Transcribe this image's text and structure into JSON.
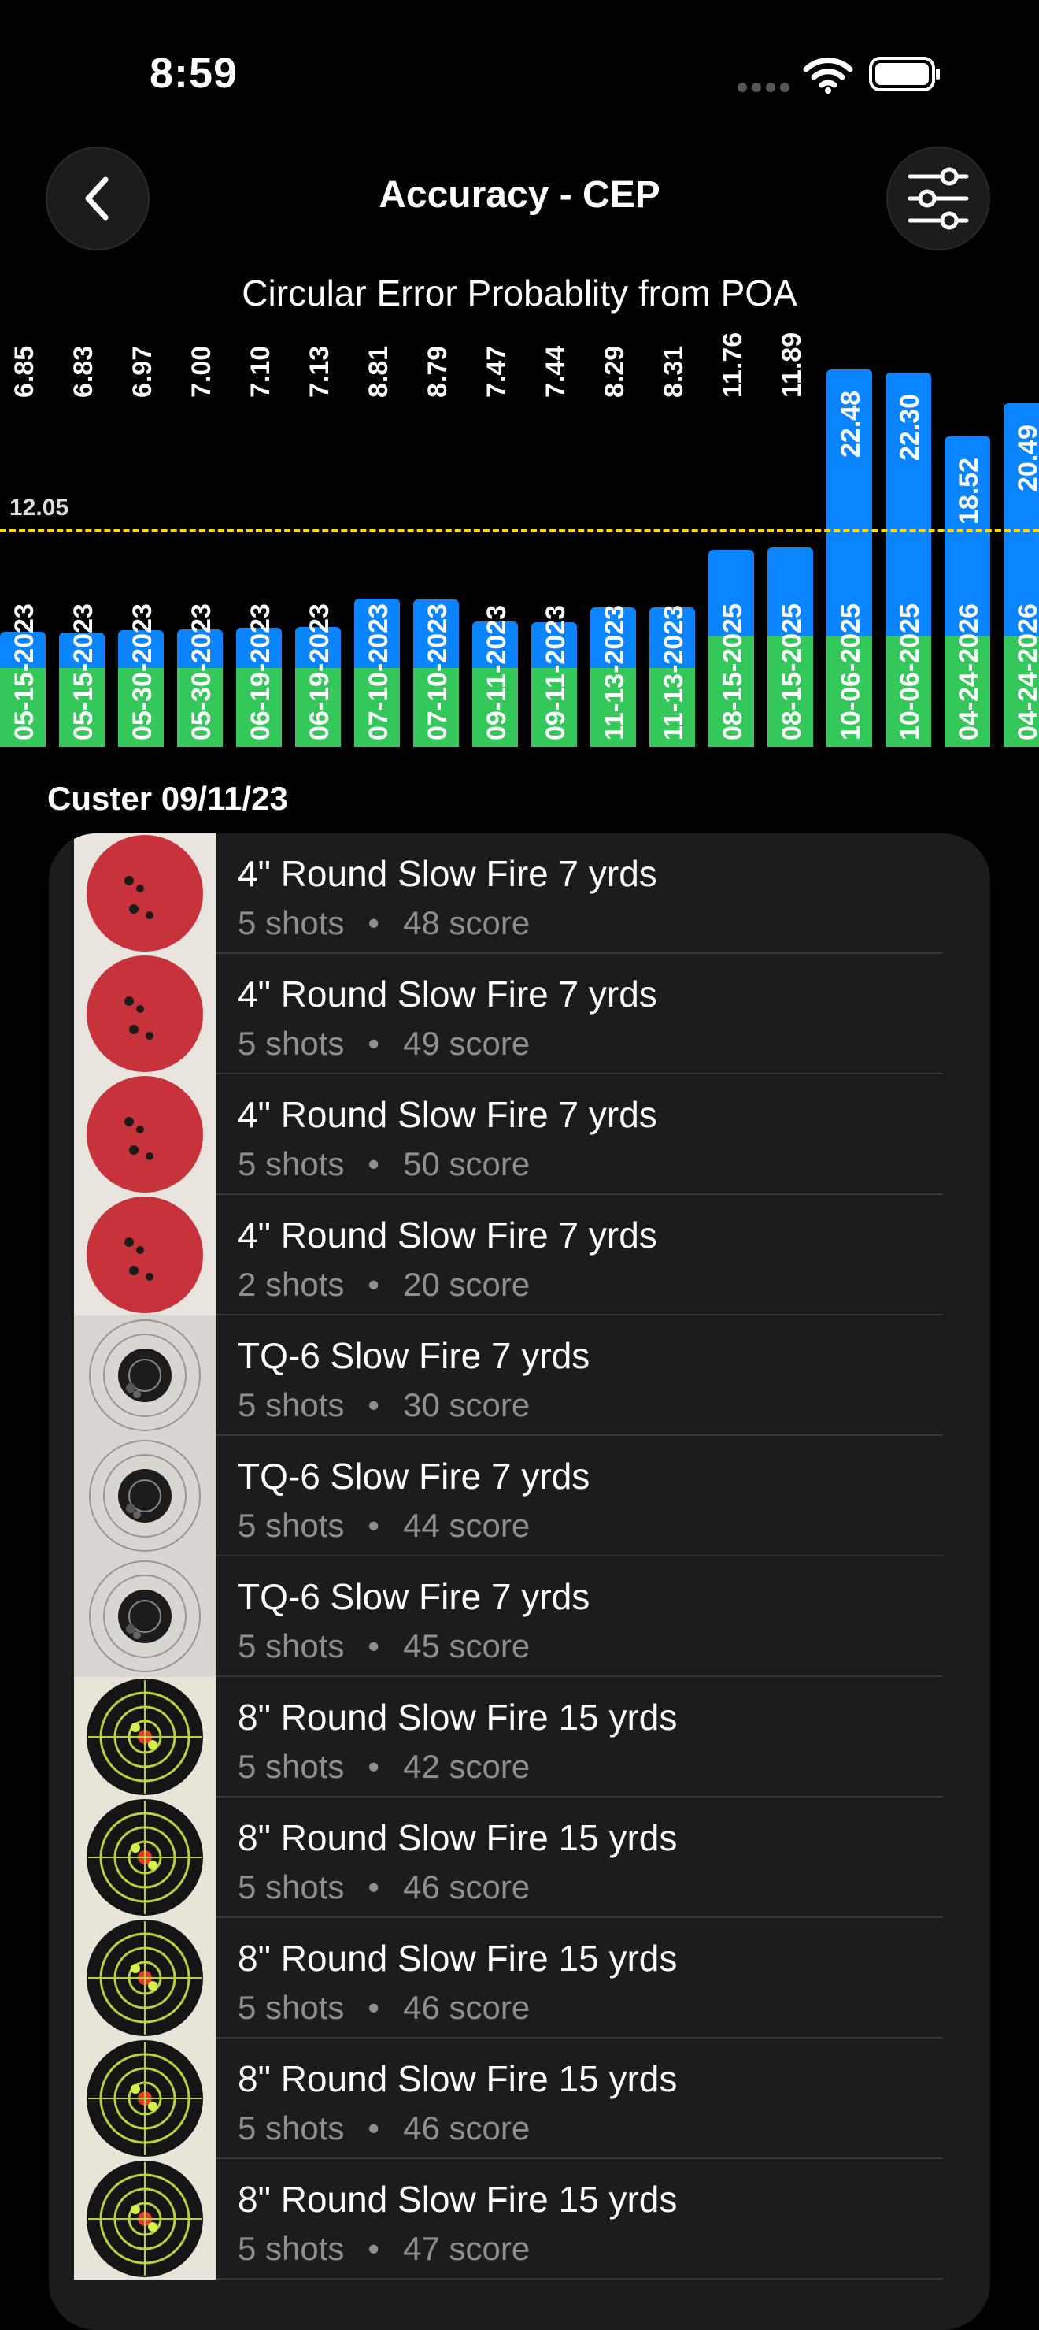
{
  "status": {
    "time": "8:59"
  },
  "nav": {
    "title": "Accuracy - CEP"
  },
  "chart_data": {
    "type": "bar",
    "title": "Circular Error Probablity from POA",
    "categories": [
      "05-15-2023",
      "05-15-2023",
      "05-30-2023",
      "05-30-2023",
      "06-19-2023",
      "06-19-2023",
      "07-10-2023",
      "07-10-2023",
      "09-11-2023",
      "09-11-2023",
      "11-13-2023",
      "11-13-2023",
      "08-15-2025",
      "08-15-2025",
      "10-06-2025",
      "10-06-2025",
      "04-24-2026",
      "04-24-2026"
    ],
    "values": [
      6.85,
      6.83,
      6.97,
      7.0,
      7.1,
      7.13,
      8.81,
      8.79,
      7.47,
      7.44,
      8.29,
      8.31,
      11.76,
      11.89,
      22.48,
      22.3,
      18.52,
      20.49
    ],
    "average_line": {
      "label": "12.05",
      "value": 12.05
    },
    "colors": {
      "base": "#34c759",
      "top": "#0a84ff",
      "average": "#ffd60a"
    }
  },
  "section": {
    "title": "Custer 09/11/23"
  },
  "sessions": [
    {
      "title": "4\" Round Slow Fire 7 yrds",
      "shots": "5 shots",
      "score": "48 score",
      "target": "red"
    },
    {
      "title": "4\" Round Slow Fire 7 yrds",
      "shots": "5 shots",
      "score": "49 score",
      "target": "red"
    },
    {
      "title": "4\" Round Slow Fire 7 yrds",
      "shots": "5 shots",
      "score": "50 score",
      "target": "red"
    },
    {
      "title": "4\" Round Slow Fire 7 yrds",
      "shots": "2 shots",
      "score": "20 score",
      "target": "red"
    },
    {
      "title": "TQ-6 Slow Fire 7 yrds",
      "shots": "5 shots",
      "score": "30 score",
      "target": "tq6"
    },
    {
      "title": "TQ-6 Slow Fire 7 yrds",
      "shots": "5 shots",
      "score": "44 score",
      "target": "tq6"
    },
    {
      "title": "TQ-6 Slow Fire 7 yrds",
      "shots": "5 shots",
      "score": "45 score",
      "target": "tq6"
    },
    {
      "title": "8\" Round Slow Fire 15 yrds",
      "shots": "5 shots",
      "score": "42 score",
      "target": "splatter"
    },
    {
      "title": "8\" Round Slow Fire 15 yrds",
      "shots": "5 shots",
      "score": "46 score",
      "target": "splatter"
    },
    {
      "title": "8\" Round Slow Fire 15 yrds",
      "shots": "5 shots",
      "score": "46 score",
      "target": "splatter"
    },
    {
      "title": "8\" Round Slow Fire 15 yrds",
      "shots": "5 shots",
      "score": "46 score",
      "target": "splatter"
    },
    {
      "title": "8\" Round Slow Fire 15 yrds",
      "shots": "5 shots",
      "score": "47 score",
      "target": "splatter"
    }
  ],
  "icons": {
    "back": "chevron-left-icon",
    "filter": "sliders-icon",
    "wifi": "wifi-icon",
    "battery": "battery-icon",
    "signal": "cellular-signal-icon"
  }
}
